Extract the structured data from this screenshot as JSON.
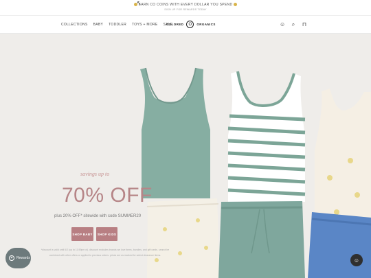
{
  "announcement": {
    "line1": "EARN CO COINS WITH EVERY DOLLAR YOU SPEND",
    "line2": "SIGN UP FOR REWARDS TODAY"
  },
  "nav": {
    "links": [
      "COLLECTIONS",
      "BABY",
      "TODDLER",
      "TOYS + MORE",
      "SALE"
    ],
    "logo_left": "COLORED",
    "logo_mark": "O",
    "logo_right": "ORGANICS",
    "icons": [
      "rewards-icon",
      "search-icon",
      "bag-icon"
    ]
  },
  "hero": {
    "kicker": "savings up to",
    "headline": "70% OFF",
    "subline": "plus 20% OFF* sitewide with code SUMMER20",
    "buttons": [
      "SHOP BABY",
      "SHOP KIDS"
    ],
    "fineprint": "*discount is valid until 6/2 (up to 11:59pm ct). discount excludes brands we love items, bundles, and gift cards. cannot be combined with other offers or applied to previous orders. prices are as marked for select clearance items."
  },
  "widgets": {
    "rewards_label": "Rewards"
  },
  "colors": {
    "accent": "#b68587",
    "button": "#b87f83",
    "sage": "#7fa79d",
    "blue": "#5b86c4"
  }
}
